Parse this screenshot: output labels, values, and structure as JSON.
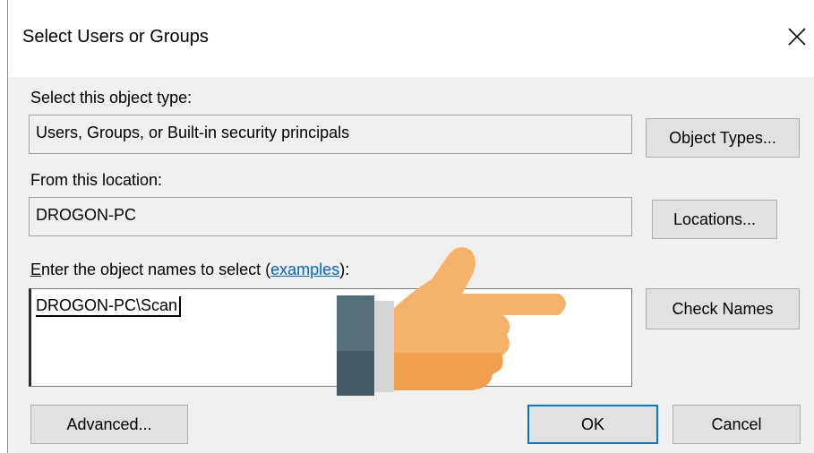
{
  "dialog": {
    "title": "Select Users or Groups"
  },
  "object_type": {
    "label": "Select this object type:",
    "value": "Users, Groups, or Built-in security principals",
    "button": "Object Types..."
  },
  "location": {
    "label": "From this location:",
    "value": "DROGON-PC",
    "button": "Locations..."
  },
  "names": {
    "label_prefix_underlined": "E",
    "label_prefix_rest": "nter the object names to select (",
    "examples_link": "examples",
    "label_suffix": "):",
    "value": "DROGON-PC\\Scan",
    "check_button": "Check Names"
  },
  "footer": {
    "advanced_button": "Advanced...",
    "ok_button": "OK",
    "cancel_button": "Cancel"
  },
  "overlay": {
    "icon": "pointing-hand-icon",
    "colors": {
      "skin": "#f5b26b",
      "skin_shadow": "#ef9f4e",
      "sleeve": "#546e7a",
      "cuff": "#d5d5d5"
    }
  }
}
